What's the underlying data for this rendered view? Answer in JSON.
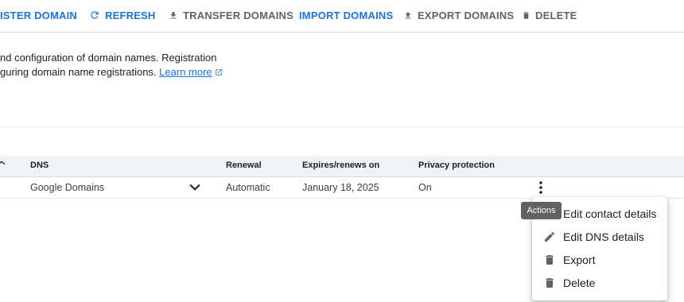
{
  "toolbar": {
    "register_label": "ISTER DOMAIN",
    "refresh_label": "REFRESH",
    "transfer_label": "TRANSFER DOMAINS",
    "import_label": "IMPORT DOMAINS",
    "export_label": "EXPORT DOMAINS",
    "delete_label": "DELETE"
  },
  "description": {
    "line1": "nd configuration of domain names. Registration",
    "line2": "guring domain name registrations. ",
    "learn_more": "Learn more"
  },
  "table": {
    "columns": {
      "dns": "DNS",
      "renewal": "Renewal",
      "expires": "Expires/renews on",
      "privacy": "Privacy protection"
    },
    "rows": [
      {
        "dns": "Google Domains",
        "renewal": "Automatic",
        "expires": "January 18, 2025",
        "privacy": "On"
      }
    ]
  },
  "tooltip": "Actions",
  "menu": {
    "items": [
      {
        "label": "Edit contact details",
        "icon": "person-icon"
      },
      {
        "label": "Edit DNS details",
        "icon": "pencil-icon"
      },
      {
        "label": "Export",
        "icon": "trash-icon"
      },
      {
        "label": "Delete",
        "icon": "trash-icon"
      }
    ]
  },
  "colors": {
    "accent": "#1a73e8",
    "muted": "#5f6368",
    "header_bg": "#f1f3f4",
    "tooltip_bg": "#616161"
  }
}
